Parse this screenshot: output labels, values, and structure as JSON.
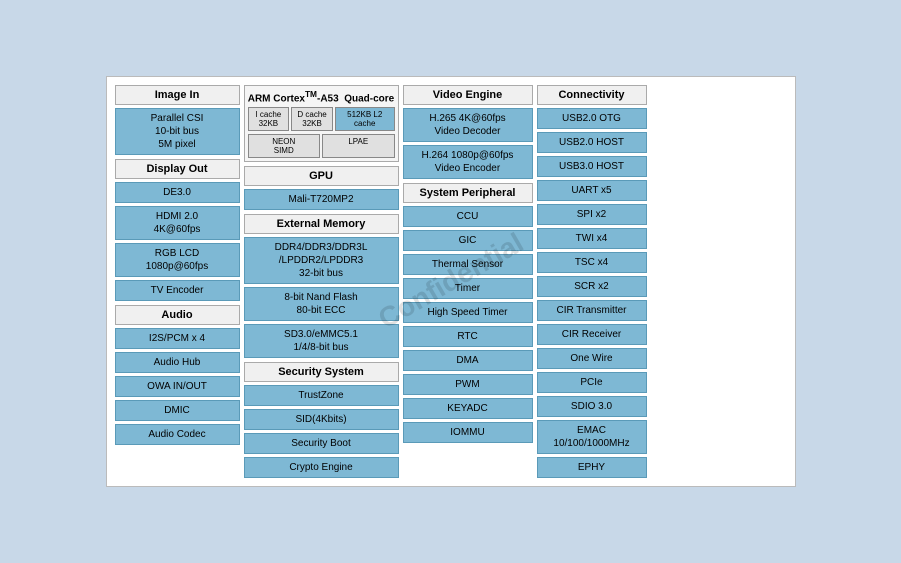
{
  "diagram": {
    "title": "ARM Cortex-A53 Quad-core",
    "watermark": "Confidential",
    "sections": {
      "imageIn": {
        "header": "Image In",
        "items": [
          "Parallel CSI\n10-bit bus\n5M pixel"
        ]
      },
      "displayOut": {
        "header": "Display Out",
        "items": [
          "DE3.0",
          "HDMI 2.0\n4K@60fps",
          "RGB LCD\n1080p@60fps",
          "TV Encoder"
        ]
      },
      "audio": {
        "header": "Audio",
        "items": [
          "I2S/PCM x 4",
          "Audio Hub",
          "OWA IN/OUT",
          "DMIC",
          "Audio Codec"
        ]
      },
      "arm": {
        "header": "ARM Cortex™-A53  Quad-core",
        "icache": "I cache\n32KB",
        "dcache": "D cache\n32KB",
        "l2cache": "512KB L2 cache",
        "neon": "NEON\nSIMD",
        "lpae": "LPAE"
      },
      "gpu": {
        "header": "GPU",
        "item": "Mali-T720MP2"
      },
      "extMem": {
        "header": "External Memory",
        "items": [
          "DDR4/DDR3/DDR3L\n/LPDDR2/LPDDR3\n32-bit bus",
          "8-bit Nand Flash\n80-bit ECC",
          "SD3.0/eMMC5.1\n1/4/8-bit bus"
        ]
      },
      "security": {
        "header": "Security System",
        "items": [
          "TrustZone",
          "SID(4Kbits)",
          "Security Boot",
          "Crypto Engine"
        ]
      },
      "videoEngine": {
        "header": "Video Engine",
        "items": [
          "H.265  4K@60fps\nVideo Decoder",
          "H.264 1080p@60fps\nVideo Encoder"
        ]
      },
      "sysPeriph": {
        "header": "System Peripheral",
        "items": [
          "CCU",
          "GIC",
          "Thermal Sensor",
          "Timer",
          "High Speed Timer",
          "RTC",
          "DMA",
          "PWM",
          "KEYADC",
          "IOMMU"
        ]
      },
      "connectivity": {
        "header": "Connectivity",
        "items": [
          "USB2.0 OTG",
          "USB2.0 HOST",
          "USB3.0 HOST",
          "UART x5",
          "SPI x2",
          "TWI x4",
          "TSC x4",
          "SCR x2",
          "CIR Transmitter",
          "CIR Receiver",
          "One Wire",
          "PCIe",
          "SDIO 3.0",
          "EMAC\n10/100/1000MHz",
          "EPHY"
        ]
      }
    }
  }
}
